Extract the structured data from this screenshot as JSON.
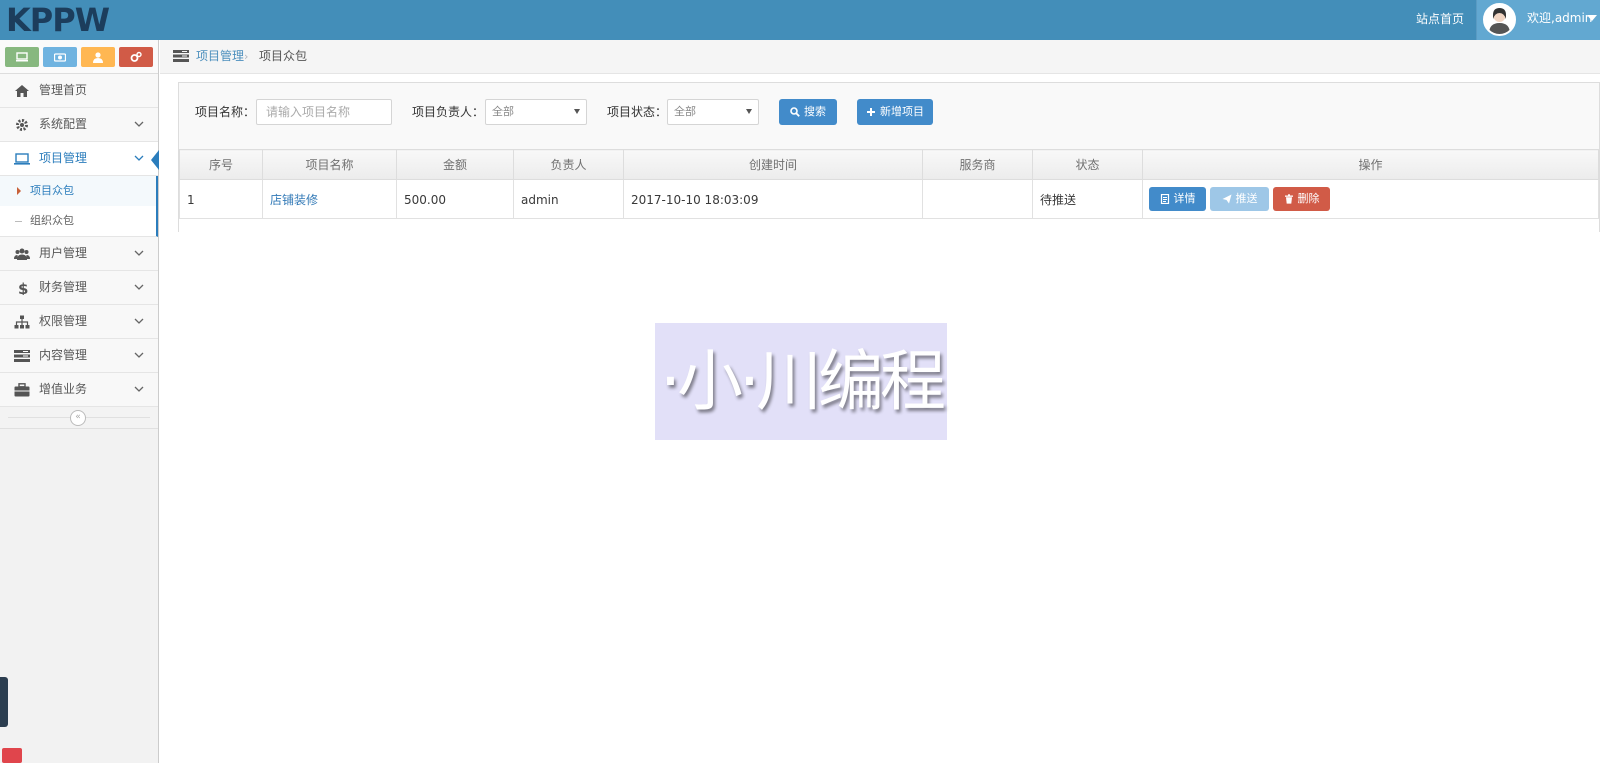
{
  "header": {
    "logo_text": "KPPW",
    "site_home": "站点首页",
    "welcome": "欢迎,admin"
  },
  "sidebar": {
    "shortcut_icons": [
      "monitor-icon",
      "camera-icon",
      "user-icon",
      "gears-icon"
    ],
    "items": [
      {
        "label": "管理首页",
        "icon": "home-icon"
      },
      {
        "label": "系统配置",
        "icon": "gear-icon"
      },
      {
        "label": "项目管理",
        "icon": "laptop-icon"
      },
      {
        "label": "用户管理",
        "icon": "users-icon"
      },
      {
        "label": "财务管理",
        "icon": "dollar-icon"
      },
      {
        "label": "权限管理",
        "icon": "sitemap-icon"
      },
      {
        "label": "内容管理",
        "icon": "list-icon"
      },
      {
        "label": "增值业务",
        "icon": "briefcase-icon"
      }
    ],
    "sub_items": [
      {
        "label": "项目众包"
      },
      {
        "label": "组织众包"
      }
    ],
    "collapse_glyph": "«"
  },
  "breadcrumb": {
    "item1": "项目管理",
    "sep": "›",
    "item2": "项目众包"
  },
  "filters": {
    "name_label": "项目名称：",
    "name_placeholder": "请输入项目名称",
    "owner_label": "项目负责人：",
    "owner_value": "全部",
    "status_label": "项目状态：",
    "status_value": "全部",
    "search_btn": "搜索",
    "add_btn": "新增项目"
  },
  "table": {
    "headers": [
      "序号",
      "项目名称",
      "金额",
      "负责人",
      "创建时间",
      "服务商",
      "状态",
      "操作"
    ],
    "rows": [
      {
        "index": "1",
        "name": "店铺装修",
        "amount": "500.00",
        "owner": "admin",
        "created": "2017-10-10 18:03:09",
        "provider": "",
        "status": "待推送",
        "actions": {
          "detail": "详情",
          "push": "推送",
          "delete": "删除"
        }
      }
    ]
  },
  "watermark": {
    "text": "·小·川编程"
  },
  "colors": {
    "topbar": "#438eb9",
    "accent": "#2b7dbc",
    "btn_primary": "#428bca",
    "btn_danger": "#d15b47",
    "btn_disabled": "#9ec7e7"
  }
}
